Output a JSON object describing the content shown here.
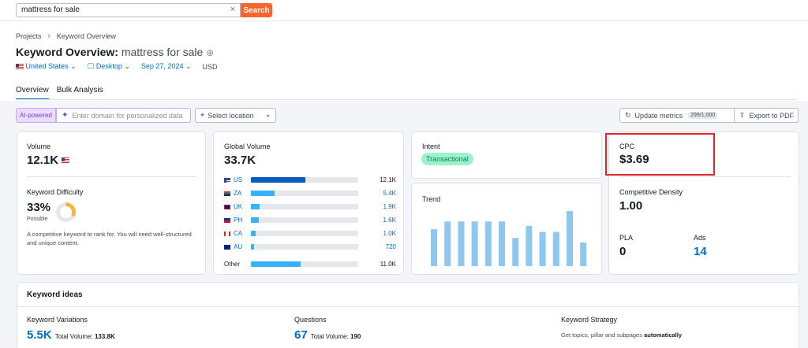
{
  "search": {
    "query": "mattress for sale",
    "button": "Search",
    "clear": "×"
  },
  "breadcrumb": {
    "projects": "Projects",
    "sep": "›",
    "current": "Keyword Overview"
  },
  "title": {
    "prefix": "Keyword Overview:",
    "keyword": "mattress for sale",
    "add": "⊕"
  },
  "filters": {
    "country": "United States",
    "device": "Desktop",
    "date": "Sep 27, 2024",
    "currency": "USD"
  },
  "tabs": [
    {
      "label": "Overview"
    },
    {
      "label": "Bulk Analysis"
    }
  ],
  "toolbar": {
    "ai_badge": "AI-powered",
    "domain_placeholder": "Enter domain for personalized data",
    "location_placeholder": "Select location",
    "update_label": "Update metrics",
    "update_count": "299/1,000",
    "export_label": "Export to PDF"
  },
  "volume": {
    "label": "Volume",
    "value": "12.1K",
    "kd_label": "Keyword Difficulty",
    "kd_value": "33%",
    "kd_level": "Possible",
    "kd_fraction": 0.33,
    "description": "A competitive keyword to rank for. You will need well-structured and unique content."
  },
  "global_volume": {
    "label": "Global Volume",
    "value": "33.7K",
    "rows": [
      {
        "code": "US",
        "value": "12.1K",
        "share": 0.36
      },
      {
        "code": "ZA",
        "value": "5.4K",
        "share": 0.16
      },
      {
        "code": "UK",
        "value": "1.9K",
        "share": 0.06
      },
      {
        "code": "PH",
        "value": "1.6K",
        "share": 0.05
      },
      {
        "code": "CA",
        "value": "1.0K",
        "share": 0.03
      },
      {
        "code": "AU",
        "value": "720",
        "share": 0.02
      }
    ],
    "other": {
      "label": "Other",
      "value": "11.0K",
      "share": 0.33
    }
  },
  "intent": {
    "label": "Intent",
    "value": "Transactional"
  },
  "trend": {
    "label": "Trend"
  },
  "chart_data": {
    "type": "bar",
    "title": "Trend",
    "categories": [
      "1",
      "2",
      "3",
      "4",
      "5",
      "6",
      "7",
      "8",
      "9",
      "10",
      "11",
      "12"
    ],
    "values": [
      0.67,
      0.81,
      0.81,
      0.81,
      0.81,
      0.81,
      0.51,
      0.73,
      0.62,
      0.62,
      1.0,
      0.43
    ],
    "extra_value": 0.81,
    "ylim": [
      0,
      1
    ],
    "color": "#8ec8f0"
  },
  "cpc": {
    "label": "CPC",
    "value": "$3.69",
    "density_label": "Competitive Density",
    "density_value": "1.00",
    "pla_label": "PLA",
    "pla_value": "0",
    "ads_label": "Ads",
    "ads_value": "14"
  },
  "ideas": {
    "title": "Keyword ideas",
    "variations": {
      "label": "Keyword Variations",
      "count": "5.5K",
      "tv_label": "Total Volume:",
      "tv_value": "133.8K"
    },
    "questions": {
      "label": "Questions",
      "count": "67",
      "tv_label": "Total Volume:",
      "tv_value": "190"
    },
    "strategy": {
      "label": "Keyword Strategy",
      "text": "Get topics, pillar and subpages",
      "bold": "automatically"
    }
  },
  "colors": {
    "accent": "#006dca",
    "search_button": "#ff642d",
    "highlight": "#e0252f"
  }
}
